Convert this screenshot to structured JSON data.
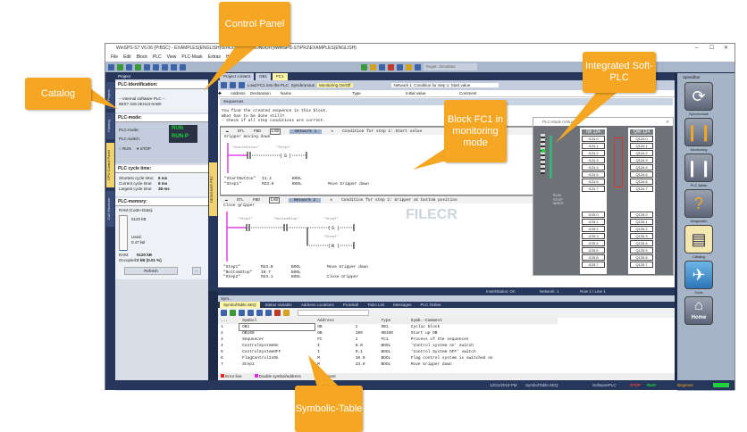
{
  "window": {
    "title": "WinSPS-S7 V6.06 (PIBSC) - EXAMPLES(ENGLISH)\\S7\\CONTROL(CONDUIT)\\WinSPS-S7\\PRJ\\EXAMPLES(ENGLISH)",
    "min": "–",
    "max": "☐",
    "close": "✕"
  },
  "menu": [
    "File",
    "Edit",
    "Block",
    "PLC",
    "View",
    "PLC-Mask",
    "Extras",
    "Help"
  ],
  "toolbar": {
    "target": "Target: Simulator"
  },
  "left_tabs": [
    "Project",
    "Catalog",
    "CPU Control Panel",
    "Call Structure"
  ],
  "editor_side_tab": "DESIGNER PRJ",
  "panel": {
    "header": "Project",
    "identification_title": "PLC-Identification:",
    "identification_text": "-- Internal software PLC --",
    "identification_id": "6ES7 315-2EH13-0AB0",
    "mode_title": "PLC-mode:",
    "mode_label": "PLC-mode:",
    "switch_label": "PLC-switch:",
    "run": "RUN",
    "runp": "RUN-P",
    "run_btn": "RUN",
    "stop_btn": "STOP",
    "cycle_title": "PLC cycle time:",
    "cycle": [
      {
        "label": "Shortest cycle time:",
        "value": "6 ms"
      },
      {
        "label": "Current cycle time:",
        "value": "6 ms"
      },
      {
        "label": "Largest cycle time:",
        "value": "38 ms"
      }
    ],
    "memory_title": "PLC-memory:",
    "ram_label": "RAM (Code+Data):",
    "ram_total": "5120 kB",
    "used_label": "Used:",
    "used_value": "0.47 kB",
    "ram_row_label": "RAM:",
    "ram_row_value": "5120 kB",
    "occupied_label": "Occupied:",
    "occupied_value": "0 kB (0.01 %)",
    "used_fraction": 0.0001,
    "refresh": "Refresh"
  },
  "editor": {
    "tabs": [
      "Project content",
      "OB1",
      "FC1"
    ],
    "load_btn": "Load FC1 into the PLC",
    "synth_btn": "Synchronous",
    "monitor_btn": "Monitoring On/Off",
    "network_info": "Network 1: Condition for step 1: Start value",
    "columns": [
      "Address",
      "Declaration",
      "Name",
      "Type",
      "Initial value",
      "Comment"
    ],
    "block_title": "Sequences",
    "comments": [
      "You find the created sequence in this block.",
      "What has to be done still?",
      "- Check if all step conditions are correct."
    ],
    "networks": [
      {
        "modes": [
          "STL",
          "FBD",
          "LAD"
        ],
        "label": "Network 1",
        "title": "Condition for step 1: Start value",
        "comment": "Gripper moving down",
        "ops": [
          "\"StartButton\"",
          "\"Step1\"",
          "S"
        ],
        "symbols": [
          [
            "\"StartButton\"",
            "I1.2",
            "BOOL",
            ""
          ],
          [
            "\"Step1\"",
            "M23.0",
            "BOOL",
            "Move Gripper down"
          ]
        ]
      },
      {
        "modes": [
          "STL",
          "FBD",
          "LAD"
        ],
        "label": "Network 2",
        "title": "Condition for step 2: Gripper at bottom position",
        "comment": "Close gripper",
        "ops": [
          "\"Step1\"",
          "\"BottomStop\"",
          "\"Step2\"",
          "S",
          "\"Step1\"",
          "R"
        ],
        "symbols": [
          [
            "\"Step1\"",
            "M23.0",
            "BOOL",
            "Move Gripper down"
          ],
          [
            "\"BottomStop\"",
            "I0.7",
            "BOOL",
            ""
          ],
          [
            "\"Step2\"",
            "M23.1",
            "BOOL",
            "Close Gripper"
          ]
        ]
      }
    ],
    "status": [
      "InsertStatus: On",
      "Network: 1",
      "Row 1 / Line 1"
    ]
  },
  "plc": {
    "title": "PLC-Mask (Virtual)",
    "in_header": "IW 124",
    "out_header": "QW 124",
    "switch": [
      "RUN",
      "STOP",
      "MRES"
    ],
    "inputs": [
      "I124.0",
      "I124.1",
      "I124.2",
      "I124.3",
      "I124.4",
      "I124.5",
      "I124.6",
      "I124.7",
      "I125.0",
      "I125.1",
      "I125.2",
      "I125.3",
      "I125.4",
      "I125.5",
      "I125.6",
      "I125.7"
    ],
    "outputs": [
      "Q124.0",
      "Q124.1",
      "Q124.2",
      "Q124.3",
      "Q124.4",
      "Q124.5",
      "Q124.6",
      "Q124.7",
      "Q125.0",
      "Q125.1",
      "Q125.2",
      "Q125.3",
      "Q125.4",
      "Q125.5",
      "Q125.6",
      "Q125.7"
    ]
  },
  "right": {
    "header": "Speedbar",
    "items": [
      "Synchronize",
      "Monitoring",
      "PLC-Mask",
      "Diagnostic",
      "Catalog",
      "Tools",
      "Home"
    ]
  },
  "bottom": {
    "title": "Sym...",
    "tabs": [
      "SymbolTable.SEQ",
      "Status Variable",
      "Address Locations",
      "Protokoll",
      "ToDo List",
      "Messages",
      "PLC Online"
    ],
    "columns": [
      "...",
      "Symbol",
      "Address",
      "",
      "Type",
      "Symb.-Comment"
    ],
    "rows": [
      [
        "1",
        "OB1",
        "OB",
        "1",
        "OB1",
        "Cyclic block"
      ],
      [
        "2",
        "OB100",
        "OB",
        "100",
        "OB100",
        "Start up OB"
      ],
      [
        "3",
        "Sequencer",
        "FC",
        "1",
        "FC1",
        "Process of the sequences"
      ],
      [
        "4",
        "ControlSystemOn",
        "I",
        "0.0",
        "BOOL",
        "'Control system on' switch"
      ],
      [
        "5",
        "ControlSystemOFF",
        "I",
        "0.1",
        "BOOL",
        "'Control System OFF' switch"
      ],
      [
        "6",
        "FlagControlIsOn",
        "M",
        "10.0",
        "BOOL",
        "Flag control system is switched on"
      ],
      [
        "7",
        "Step1",
        "M",
        "23.0",
        "BOOL",
        "Move Gripper down"
      ]
    ],
    "legend": [
      "Error line",
      "Double symbol/address",
      "Comment"
    ]
  },
  "statusbar": {
    "date": "12/21/2019 PM",
    "file": "SymbolTable.SEQ",
    "plc": "SoftwarePLC",
    "stop": "STOP",
    "run": "RUN",
    "user": "Beginner"
  },
  "callouts": {
    "control": "Control Panel",
    "catalog": "Catalog",
    "softplc": "Integrated Soft-PLC",
    "block": "Block FC1 in monitoring mode",
    "symtable": "Symbolic-Table"
  },
  "watermark": "FILECR",
  "colors": {
    "accent": "#f5a623",
    "navy": "#1e2b48",
    "run": "#1fd33a"
  }
}
